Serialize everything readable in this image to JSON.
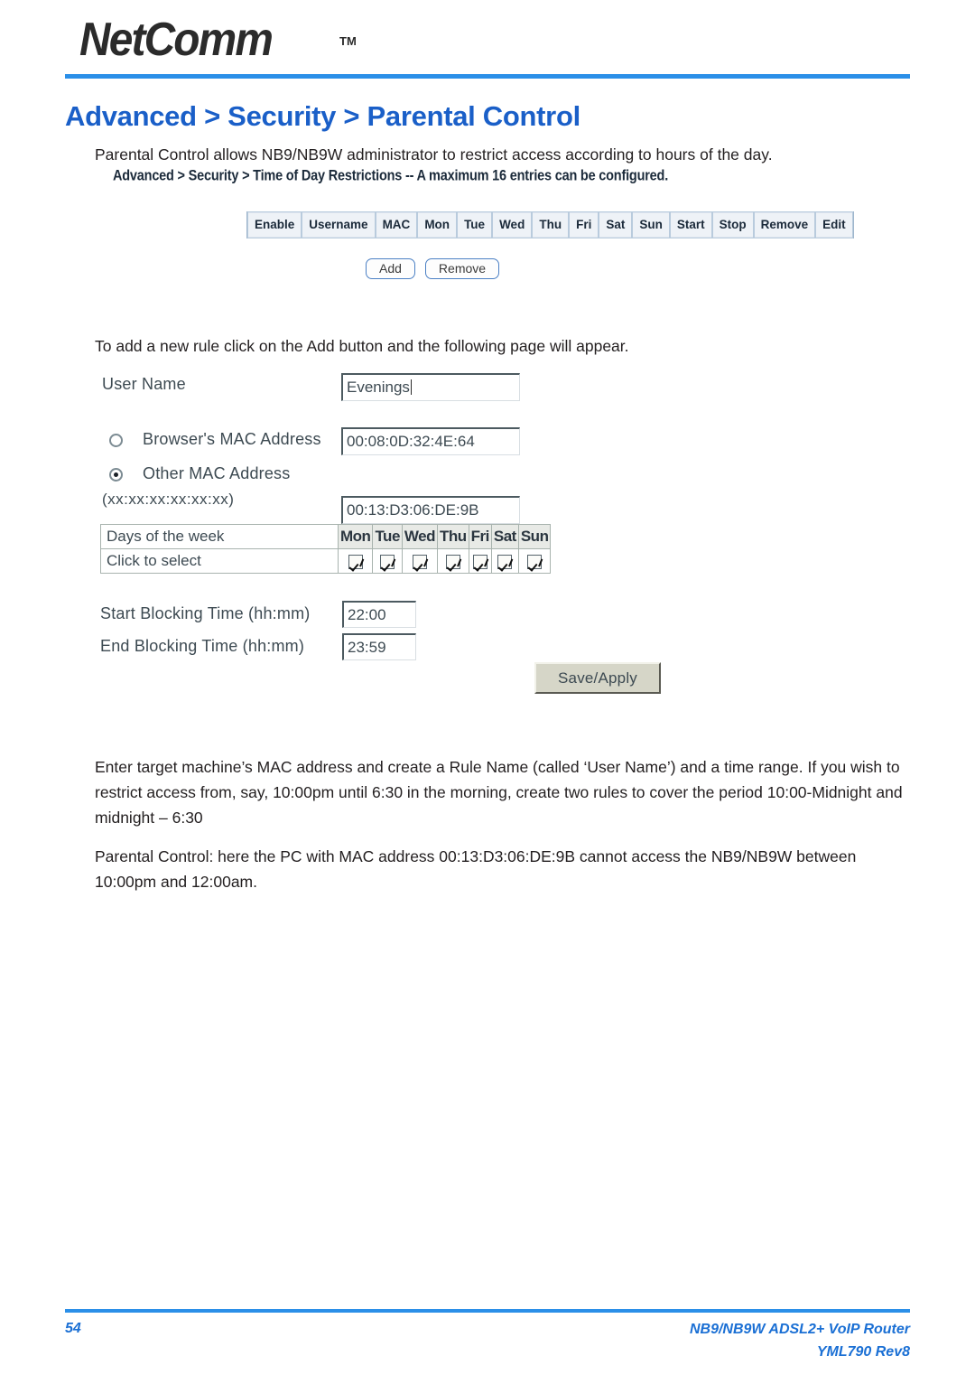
{
  "header": {
    "logo_text": "NetComm",
    "logo_trademark": "TM",
    "title": "Advanced > Security > Parental Control"
  },
  "paragraphs": {
    "intro": "Parental Control allows NB9/NB9W administrator to restrict access according to hours of the day.",
    "add_rule": "To add a new rule click on the Add button and the following page will appear.",
    "explain": "Enter target machine’s MAC address and create a Rule Name (called ‘User Name’) and a time range.  If you wish to restrict access from, say, 10:00pm until 6:30 in the morning, create two rules to cover the period 10:00-Midnight and midnight – 6:30",
    "summary": "Parental Control: here the PC with MAC address 00:13:D3:06:DE:9B cannot access the NB9/NB9W between 10:00pm and 12:00am."
  },
  "screenshot_tod": {
    "caption": "Advanced > Security > Time of Day Restrictions -- A maximum 16 entries can be configured.",
    "columns": [
      "Enable",
      "Username",
      "MAC",
      "Mon",
      "Tue",
      "Wed",
      "Thu",
      "Fri",
      "Sat",
      "Sun",
      "Start",
      "Stop",
      "Remove",
      "Edit"
    ],
    "buttons": {
      "add": "Add",
      "remove": "Remove"
    }
  },
  "screenshot_form": {
    "username": {
      "label": "User Name",
      "value": "Evenings"
    },
    "mac_source": {
      "browser": {
        "label": "Browser's MAC Address",
        "value": "00:08:0D:32:4E:64",
        "selected": false
      },
      "other": {
        "label": "Other MAC Address",
        "value": "00:13:D3:06:DE:9B",
        "selected": true
      },
      "format_hint": "(xx:xx:xx:xx:xx:xx)"
    },
    "days": {
      "header_label": "Days of the week",
      "select_label": "Click to select",
      "names": [
        "Mon",
        "Tue",
        "Wed",
        "Thu",
        "Fri",
        "Sat",
        "Sun"
      ],
      "checked": [
        true,
        true,
        true,
        true,
        true,
        true,
        true
      ]
    },
    "start_time": {
      "label": "Start Blocking Time (hh:mm)",
      "value": "22:00"
    },
    "end_time": {
      "label": "End Blocking Time (hh:mm)",
      "value": "23:59"
    },
    "save_button": "Save/Apply"
  },
  "footer": {
    "page_number": "54",
    "product": "NB9/NB9W ADSL2+ VoIP Router",
    "doc_code": "YML790 Rev8"
  },
  "colors": {
    "rule_blue": "#2b8fe8",
    "title_blue": "#1a5fc8",
    "footer_blue": "#1a6fd4"
  }
}
